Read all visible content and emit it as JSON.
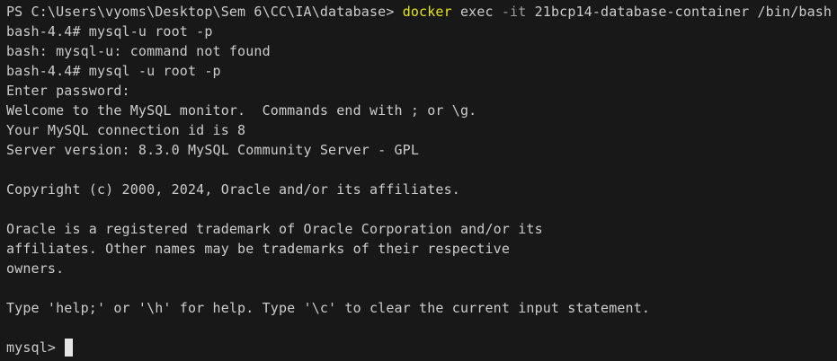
{
  "terminal": {
    "colors": {
      "background": "#181818",
      "text": "#cccccc",
      "command_highlight": "#e5e510",
      "flag_dim": "#9d9d9d",
      "cursor": "#e5e5e5"
    },
    "ps_line": {
      "prompt": "PS C:\\Users\\vyoms\\Desktop\\Sem 6\\CC\\IA\\database> ",
      "command": "docker",
      "arg1": " exec ",
      "flag": "-it",
      "arg2": " 21bcp14-database-container /bin/bash"
    },
    "lines": [
      "bash-4.4# mysql-u root -p",
      "bash: mysql-u: command not found",
      "bash-4.4# mysql -u root -p",
      "Enter password:",
      "Welcome to the MySQL monitor.  Commands end with ; or \\g.",
      "Your MySQL connection id is 8",
      "Server version: 8.3.0 MySQL Community Server - GPL",
      "",
      "Copyright (c) 2000, 2024, Oracle and/or its affiliates.",
      "",
      "Oracle is a registered trademark of Oracle Corporation and/or its",
      "affiliates. Other names may be trademarks of their respective",
      "owners.",
      "",
      "Type 'help;' or '\\h' for help. Type '\\c' to clear the current input statement.",
      ""
    ],
    "mysql_prompt": "mysql> "
  }
}
